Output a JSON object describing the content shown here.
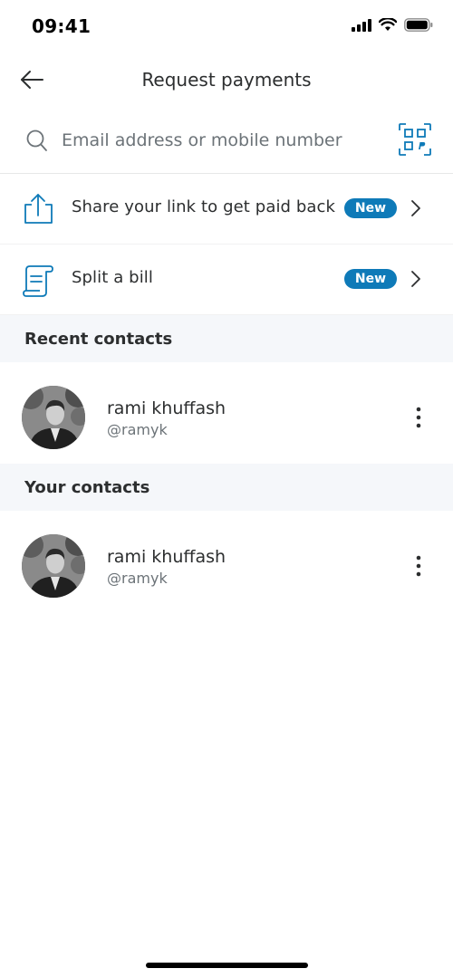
{
  "status_bar": {
    "time": "09:41"
  },
  "header": {
    "title": "Request payments"
  },
  "search": {
    "placeholder": "Email address or mobile number"
  },
  "actions": [
    {
      "label": "Share your link to get paid back",
      "badge": "New",
      "icon": "share-upload-icon"
    },
    {
      "label": "Split a bill",
      "badge": "New",
      "icon": "bill-receipt-icon"
    }
  ],
  "sections": {
    "recent": {
      "title": "Recent contacts"
    },
    "yours": {
      "title": "Your contacts"
    }
  },
  "recent_contacts": [
    {
      "name": "rami khuffash",
      "handle": "@ramyk"
    }
  ],
  "your_contacts": [
    {
      "name": "rami khuffash",
      "handle": "@ramyk"
    }
  ],
  "colors": {
    "accent": "#0e7ab8",
    "badge": "#0e7ab8",
    "section_bg": "#f5f7fa",
    "text": "#2c2e2f",
    "muted": "#6c7378"
  }
}
